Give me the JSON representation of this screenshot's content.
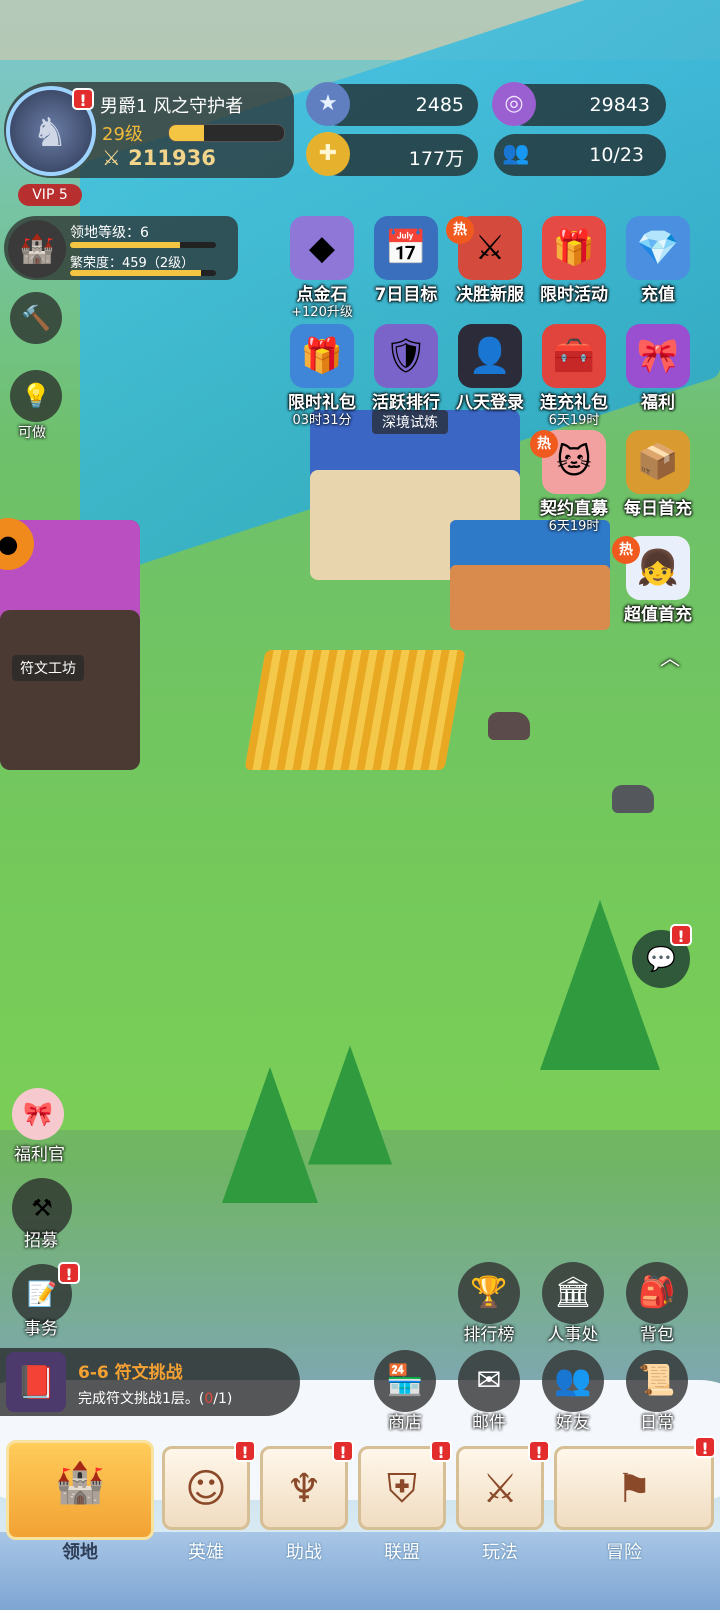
{
  "player": {
    "title_name": "男爵1 风之守护者",
    "level": "29级",
    "level_progress": 0.3,
    "power": "211936",
    "vip": "VIP 5",
    "avatar_badge": "!"
  },
  "territory": {
    "level": "领地等级：6",
    "level_progress": 0.75,
    "prosperity": "繁荣度：459（2级）",
    "prosperity_progress": 0.9
  },
  "resources": {
    "gems": "2485",
    "crystals": "29843",
    "gold": "177万",
    "population": "10/23"
  },
  "side_left": {
    "hint_label": "可做",
    "welfare_officer": "福利官",
    "recruit": "招募",
    "affairs": "事务",
    "affairs_badge": "!"
  },
  "events": [
    {
      "label": "点金石",
      "sub": "+120升级",
      "icon": "gold-stone-icon"
    },
    {
      "label": "7日目标",
      "sub": "",
      "icon": "calendar-icon"
    },
    {
      "label": "决胜新服",
      "sub": "",
      "hot": "热",
      "icon": "crossed-swords-icon"
    },
    {
      "label": "限时活动",
      "sub": "",
      "icon": "treasure-chest-icon"
    },
    {
      "label": "充值",
      "sub": "",
      "icon": "diamond-pack-icon"
    },
    {
      "label": "限时礼包",
      "sub": "03时31分",
      "icon": "gift-box-icon"
    },
    {
      "label": "活跃排行",
      "sub": "",
      "icon": "rank-shield-icon"
    },
    {
      "label": "八天登录",
      "sub": "",
      "icon": "hero-portrait-icon"
    },
    {
      "label": "连充礼包",
      "sub": "6天19时",
      "icon": "red-chest-icon"
    },
    {
      "label": "福利",
      "sub": "",
      "icon": "purple-gift-icon"
    },
    {
      "label": "契约直募",
      "sub": "6天19时",
      "hot": "热",
      "icon": "cat-girl-icon"
    },
    {
      "label": "每日首充",
      "sub": "",
      "icon": "golden-chest-icon"
    },
    {
      "label": "超值首充",
      "sub": "",
      "hot": "热",
      "icon": "white-hair-girl-icon"
    }
  ],
  "scene_labels": {
    "trial": "深境试炼",
    "rune_workshop": "符文工坊"
  },
  "right_buttons": [
    {
      "label": "排行榜",
      "icon": "trophy-icon"
    },
    {
      "label": "人事处",
      "icon": "hall-icon"
    },
    {
      "label": "背包",
      "icon": "backpack-icon"
    },
    {
      "label": "商店",
      "icon": "shop-icon"
    },
    {
      "label": "邮件",
      "icon": "mail-icon"
    },
    {
      "label": "好友",
      "icon": "friends-icon"
    },
    {
      "label": "日常",
      "icon": "scroll-icon"
    }
  ],
  "chat_badge": "!",
  "quest": {
    "title": "6-6 符文挑战",
    "desc_prefix": "完成符文挑战1层。(",
    "desc_progress": "0",
    "desc_suffix": "/1)"
  },
  "nav": {
    "tabs": [
      {
        "label": "领地",
        "active": true
      },
      {
        "label": "英雄",
        "badge": "!"
      },
      {
        "label": "助战",
        "badge": "!"
      },
      {
        "label": "联盟",
        "badge": "!"
      },
      {
        "label": "玩法",
        "badge": "!"
      },
      {
        "label": "冒险",
        "badge": "!"
      }
    ]
  },
  "colors": {
    "accent_gold": "#f4c542",
    "hot_orange": "#f05a1f",
    "badge_red": "#e32d2d",
    "quest_orange": "#f4a133"
  }
}
